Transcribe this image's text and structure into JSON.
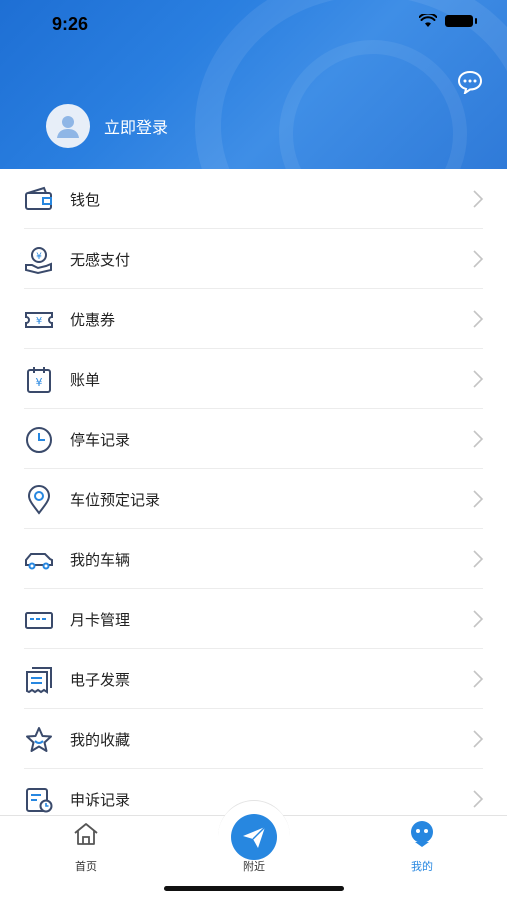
{
  "status_bar": {
    "time": "9:26"
  },
  "header": {
    "login_label": "立即登录"
  },
  "menu": [
    {
      "label": "钱包",
      "icon": "wallet-icon"
    },
    {
      "label": "无感支付",
      "icon": "hand-payment-icon"
    },
    {
      "label": "优惠券",
      "icon": "coupon-icon"
    },
    {
      "label": "账单",
      "icon": "bill-icon"
    },
    {
      "label": "停车记录",
      "icon": "clock-icon"
    },
    {
      "label": "车位预定记录",
      "icon": "location-pin-icon"
    },
    {
      "label": "我的车辆",
      "icon": "car-icon"
    },
    {
      "label": "月卡管理",
      "icon": "card-icon"
    },
    {
      "label": "电子发票",
      "icon": "invoice-icon"
    },
    {
      "label": "我的收藏",
      "icon": "star-icon"
    },
    {
      "label": "申诉记录",
      "icon": "appeal-record-icon"
    }
  ],
  "tabs": {
    "home": "首页",
    "nearby": "附近",
    "mine": "我的"
  },
  "colors": {
    "accent": "#2787e0",
    "header": "#2a7fe0",
    "icon_stroke": "#3a4a6b"
  }
}
